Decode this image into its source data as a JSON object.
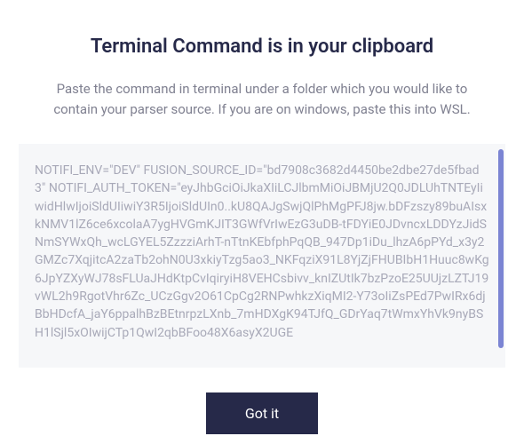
{
  "header": {
    "title": "Terminal Command is in your clipboard",
    "subtitle": "Paste the command in terminal under a folder which you would like to contain your parser source. If you are on windows, paste this into WSL."
  },
  "code": {
    "content": "NOTIFI_ENV=\"DEV\" FUSION_SOURCE_ID=\"bd7908c3682d4450be2dbe27de5fbad3\" NOTIFI_AUTH_TOKEN=\"eyJhbGciOiJkaXIiLCJlbmMiOiJBMjU2Q0JDLUhTNTEyIiwidHlwIjoiSldUIiwiY3R5IjoiSldUIn0..kU8QAJgSwjQlPhMgPFJ8jw.bDFzszy89buAIsxkNMV1lZ6ce6xcolaA7ygHVGmKJIT3GWfVrIwEzG3uDB-tFDYiE0JDvncxLDDYzJidSNmSYWxQh_wcLGYEL5ZzzziArhT-nTtnKEbfphPqQB_947Dp1iDu_lhzA6pPYd_x3y2GMZc7XqjitcA2zaTb2ohN0U3xkiyTzg5ao3_NKFqziX91L8YjZjFHUBIbH1Huuc8wKg6JpYZXyWJ78sFLUaJHdKtpCvIqiryiH8VEHCsbivv_knIZUtIk7bzPzoE25UUjzLZTJ19vWL2h9RgotVhr6Zc_UCzGgv2O61CpCg2RNPwhkzXiqMI2-Y73oIiZsPEd7PwIRx6djBbHDcfA_jaY6ppalhBzBEtnrpzLXnb_7mHDXgK94TJfQ_GDrYaq7tWmxYhVk9nyBSH1lSjl5xOIwijCTp1QwI2qbBFoo48X6asyX2UGE"
  },
  "actions": {
    "got_it_label": "Got it"
  }
}
